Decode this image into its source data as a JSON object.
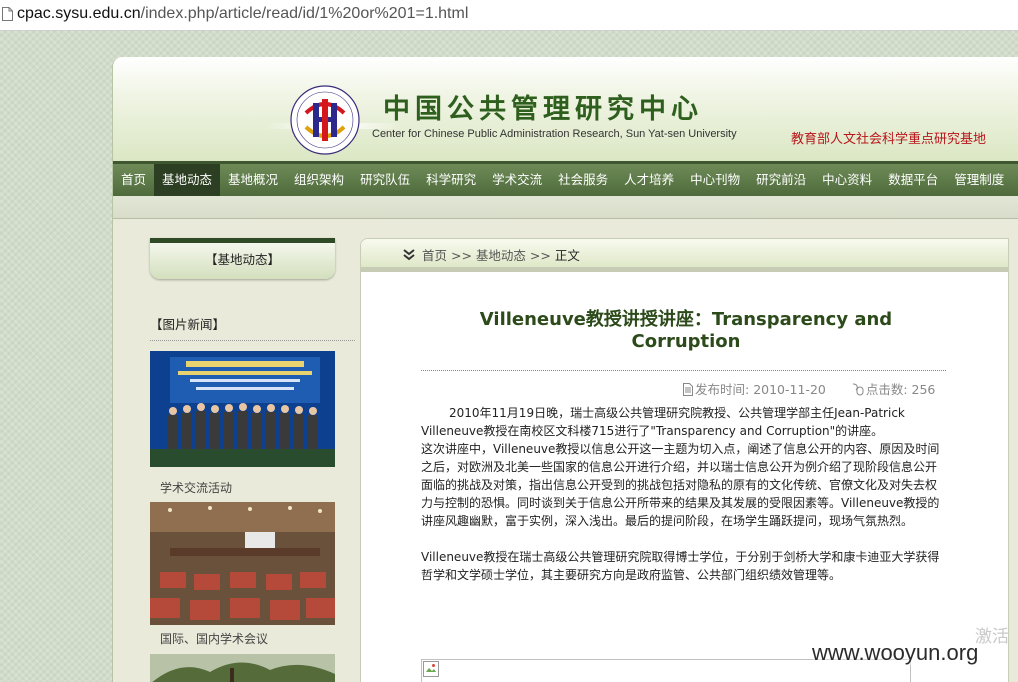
{
  "browser": {
    "url_host": "cpac.sysu.edu.cn",
    "url_path": "/index.php/article/read/id/1%20or%201=1.html"
  },
  "header": {
    "title_cn": "中国公共管理研究中心",
    "title_en": "Center for Chinese Public Administration Research, Sun Yat-sen University",
    "badge": "教育部人文社会科学重点研究基地"
  },
  "nav": {
    "items": [
      {
        "label": "首页"
      },
      {
        "label": "基地动态"
      },
      {
        "label": "基地概况"
      },
      {
        "label": "组织架构"
      },
      {
        "label": "研究队伍"
      },
      {
        "label": "科学研究"
      },
      {
        "label": "学术交流"
      },
      {
        "label": "社会服务"
      },
      {
        "label": "人才培养"
      },
      {
        "label": "中心刊物"
      },
      {
        "label": "研究前沿"
      },
      {
        "label": "中心资料"
      },
      {
        "label": "数据平台"
      },
      {
        "label": "管理制度"
      }
    ],
    "active_index": 1
  },
  "sidebar": {
    "box_title": "【基地动态】",
    "section_title": "【图片新闻】",
    "photos": [
      {
        "caption": "学术交流活动"
      },
      {
        "caption": "国际、国内学术会议"
      }
    ]
  },
  "breadcrumb": {
    "home": "首页",
    "sep1": ">>",
    "section": "基地动态",
    "sep2": ">>",
    "current": "正文"
  },
  "article": {
    "title_line1": "Villeneuve教授讲授讲座：Transparency and",
    "title_line2": "Corruption",
    "publish_label": "发布时间:",
    "publish_date": "2010-11-20",
    "clicks_label": "点击数:",
    "clicks": "256",
    "p1": "2010年11月19日晚，瑞士高级公共管理研究院教授、公共管理学部主任Jean-Patrick Villeneuve教授在南校区文科楼715进行了\"Transparency and Corruption\"的讲座。",
    "p2": "这次讲座中，Villeneuve教授以信息公开这一主题为切入点，阐述了信息公开的内容、原因及时间之后，对欧洲及北美一些国家的信息公开进行介绍，并以瑞士信息公开为例介绍了现阶段信息公开面临的挑战及对策，指出信息公开受到的挑战包括对隐私的原有的文化传统、官僚文化及对失去权力与控制的恐惧。同时谈到关于信息公开所带来的结果及其发展的受限因素等。Villeneuve教授的讲座风趣幽默，富于实例，深入浅出。最后的提问阶段，在场学生踊跃提问，现场气氛热烈。",
    "p3": "Villeneuve教授在瑞士高级公共管理研究院取得博士学位，于分别于剑桥大学和康卡迪亚大学获得哲学和文学硕士学位，其主要研究方向是政府监管、公共部门组织绩效管理等。"
  },
  "overlay": {
    "activate_text": "激活",
    "watermark": "www.wooyun.org"
  },
  "colors": {
    "nav_bg": "#5a7746",
    "nav_active": "#2c3f22",
    "title_green": "#2f5f1e",
    "badge_red": "#b8141a"
  }
}
